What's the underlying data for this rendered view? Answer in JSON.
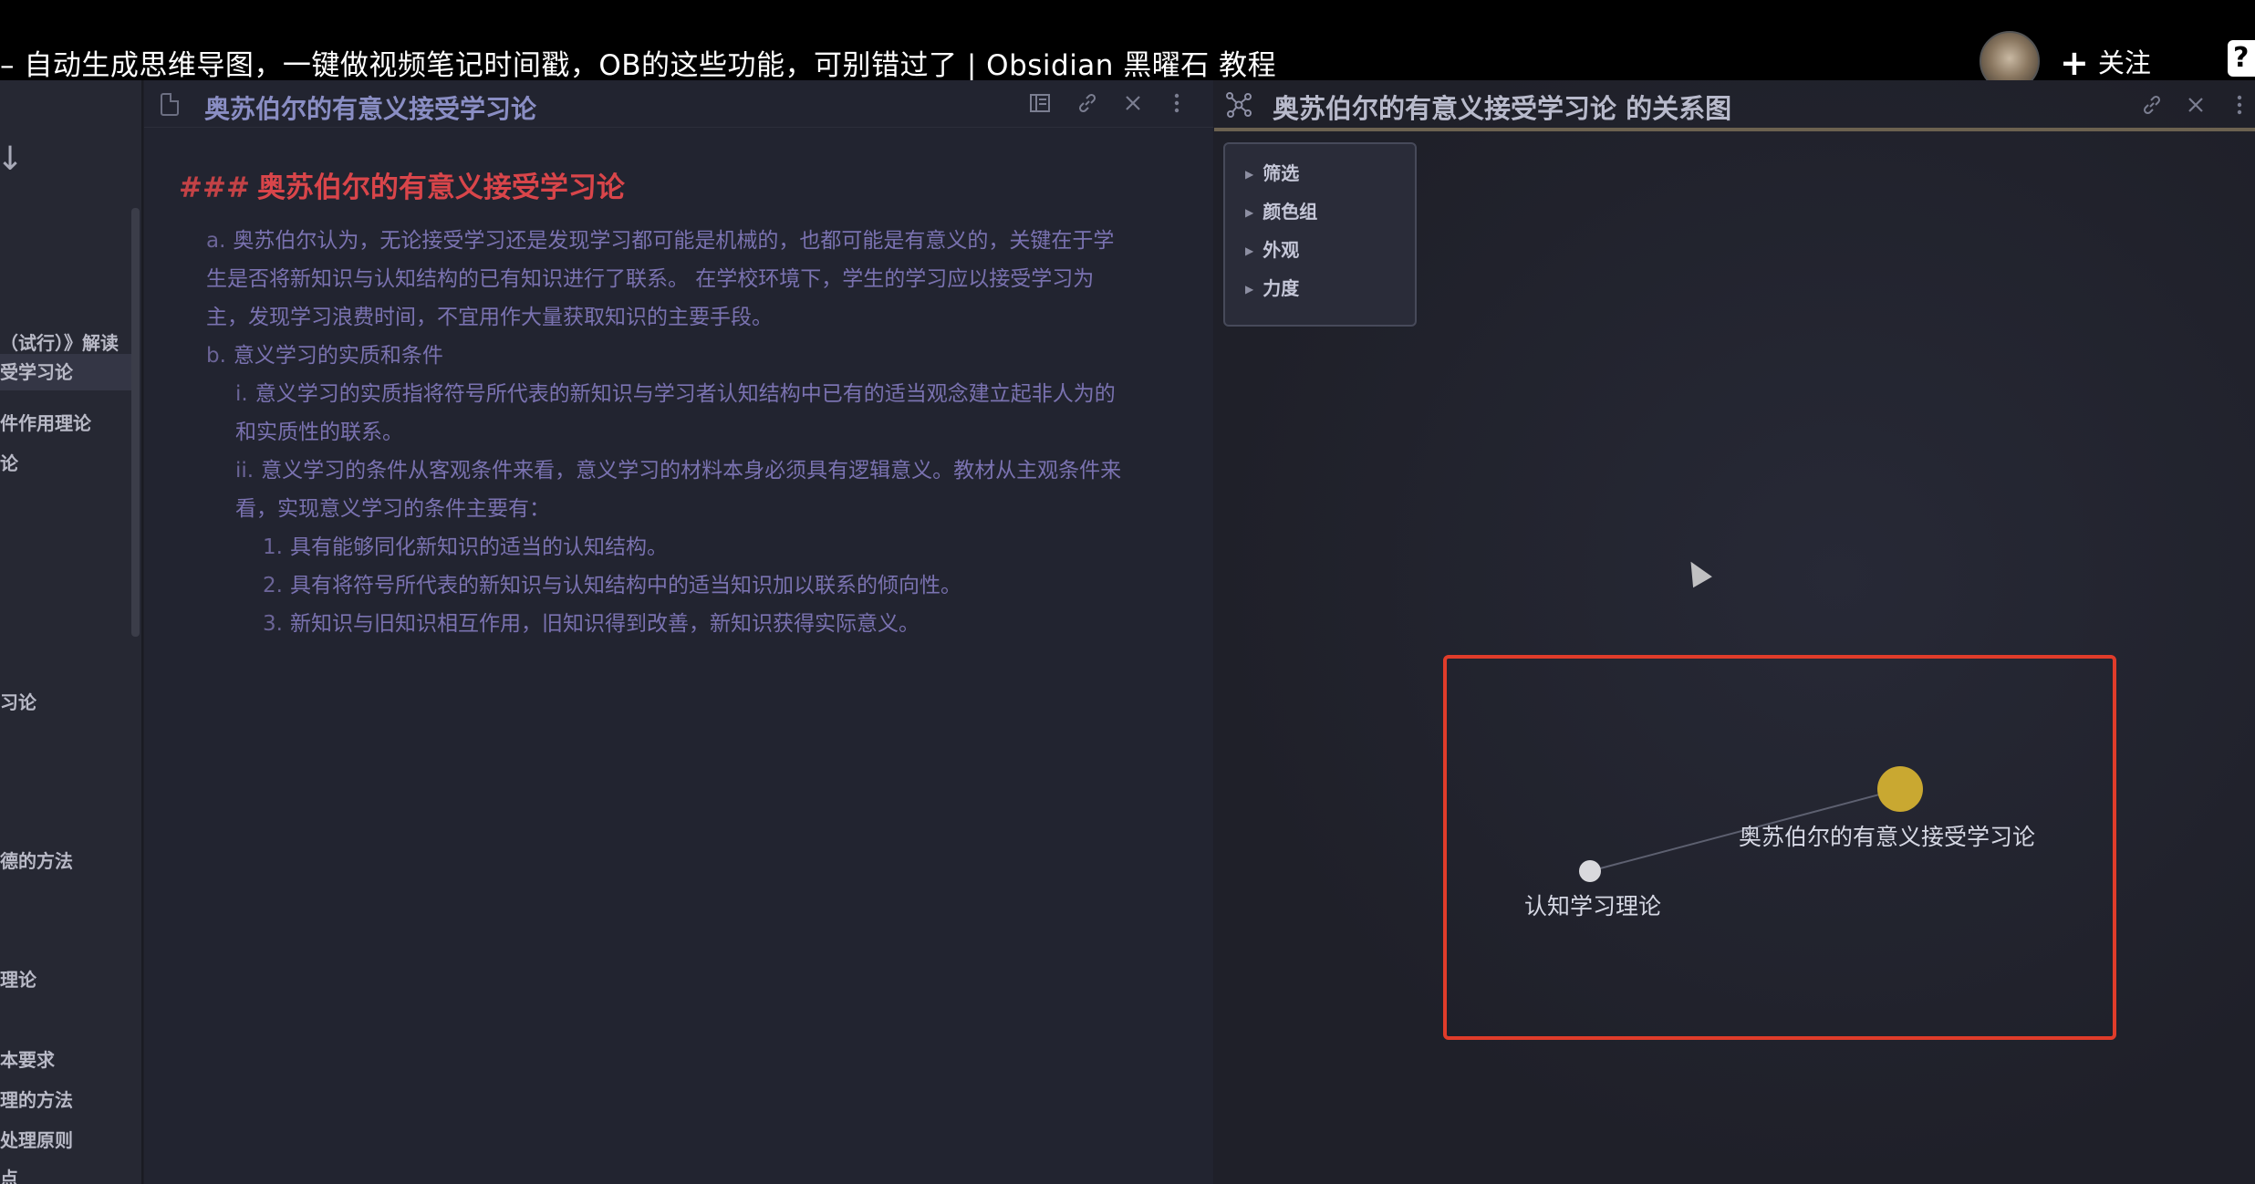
{
  "video": {
    "title": "– 自动生成思维导图，一键做视频笔记时间戳，OB的这些功能，可别错过了 | Obsidian 黑曜石 教程",
    "follow_label": "关注",
    "plus": "+",
    "corner_glyph": "?"
  },
  "sidebar": {
    "arrow": "↓",
    "items": [
      {
        "label": "（试行）》解读",
        "active": false
      },
      {
        "label": "受学习论",
        "active": true
      },
      {
        "label": "件作用理论",
        "active": false
      },
      {
        "label": "论",
        "active": false
      },
      {
        "label": "习论",
        "active": false
      },
      {
        "label": "德的方法",
        "active": false
      },
      {
        "label": "理论",
        "active": false
      },
      {
        "label": "本要求",
        "active": false
      },
      {
        "label": "理的方法",
        "active": false
      },
      {
        "label": "处理原则",
        "active": false
      },
      {
        "label": "点",
        "active": false
      }
    ]
  },
  "editor": {
    "title": "奥苏伯尔的有意义接受学习论",
    "heading_hash": "###",
    "heading": "奥苏伯尔的有意义接受学习论",
    "paragraphs": [
      {
        "level": 0,
        "marker": "a.",
        "text": "奥苏伯尔认为，无论接受学习还是发现学习都可能是机械的，也都可能是有意义的，关键在于学生是否将新知识与认知结构的已有知识进行了联系。 在学校环境下，学生的学习应以接受学习为主，发现学习浪费时间，不宜用作大量获取知识的主要手段。"
      },
      {
        "level": 0,
        "marker": "b.",
        "text": "意义学习的实质和条件"
      },
      {
        "level": 1,
        "marker": "i.",
        "text": "意义学习的实质指将符号所代表的新知识与学习者认知结构中已有的适当观念建立起非人为的和实质性的联系。"
      },
      {
        "level": 1,
        "marker": "ii.",
        "text": "意义学习的条件从客观条件来看，意义学习的材料本身必须具有逻辑意义。教材从主观条件来看，实现意义学习的条件主要有："
      },
      {
        "level": 2,
        "marker": "1.",
        "text": "具有能够同化新知识的适当的认知结构。"
      },
      {
        "level": 2,
        "marker": "2.",
        "text": "具有将符号所代表的新知识与认知结构中的适当知识加以联系的倾向性。"
      },
      {
        "level": 2,
        "marker": "3.",
        "text": "新知识与旧知识相互作用，旧知识得到改善，新知识获得实际意义。"
      }
    ]
  },
  "graph": {
    "title": "奥苏伯尔的有意义接受学习论 的关系图",
    "filter_items": [
      "筛选",
      "颜色组",
      "外观",
      "力度"
    ],
    "nodes": {
      "main": {
        "label": "奥苏伯尔的有意义接受学习论",
        "color": "#c9a831"
      },
      "other": {
        "label": "认知学习理论",
        "color": "#d9d9dd"
      }
    },
    "highlight_color": "#e03c2a"
  }
}
